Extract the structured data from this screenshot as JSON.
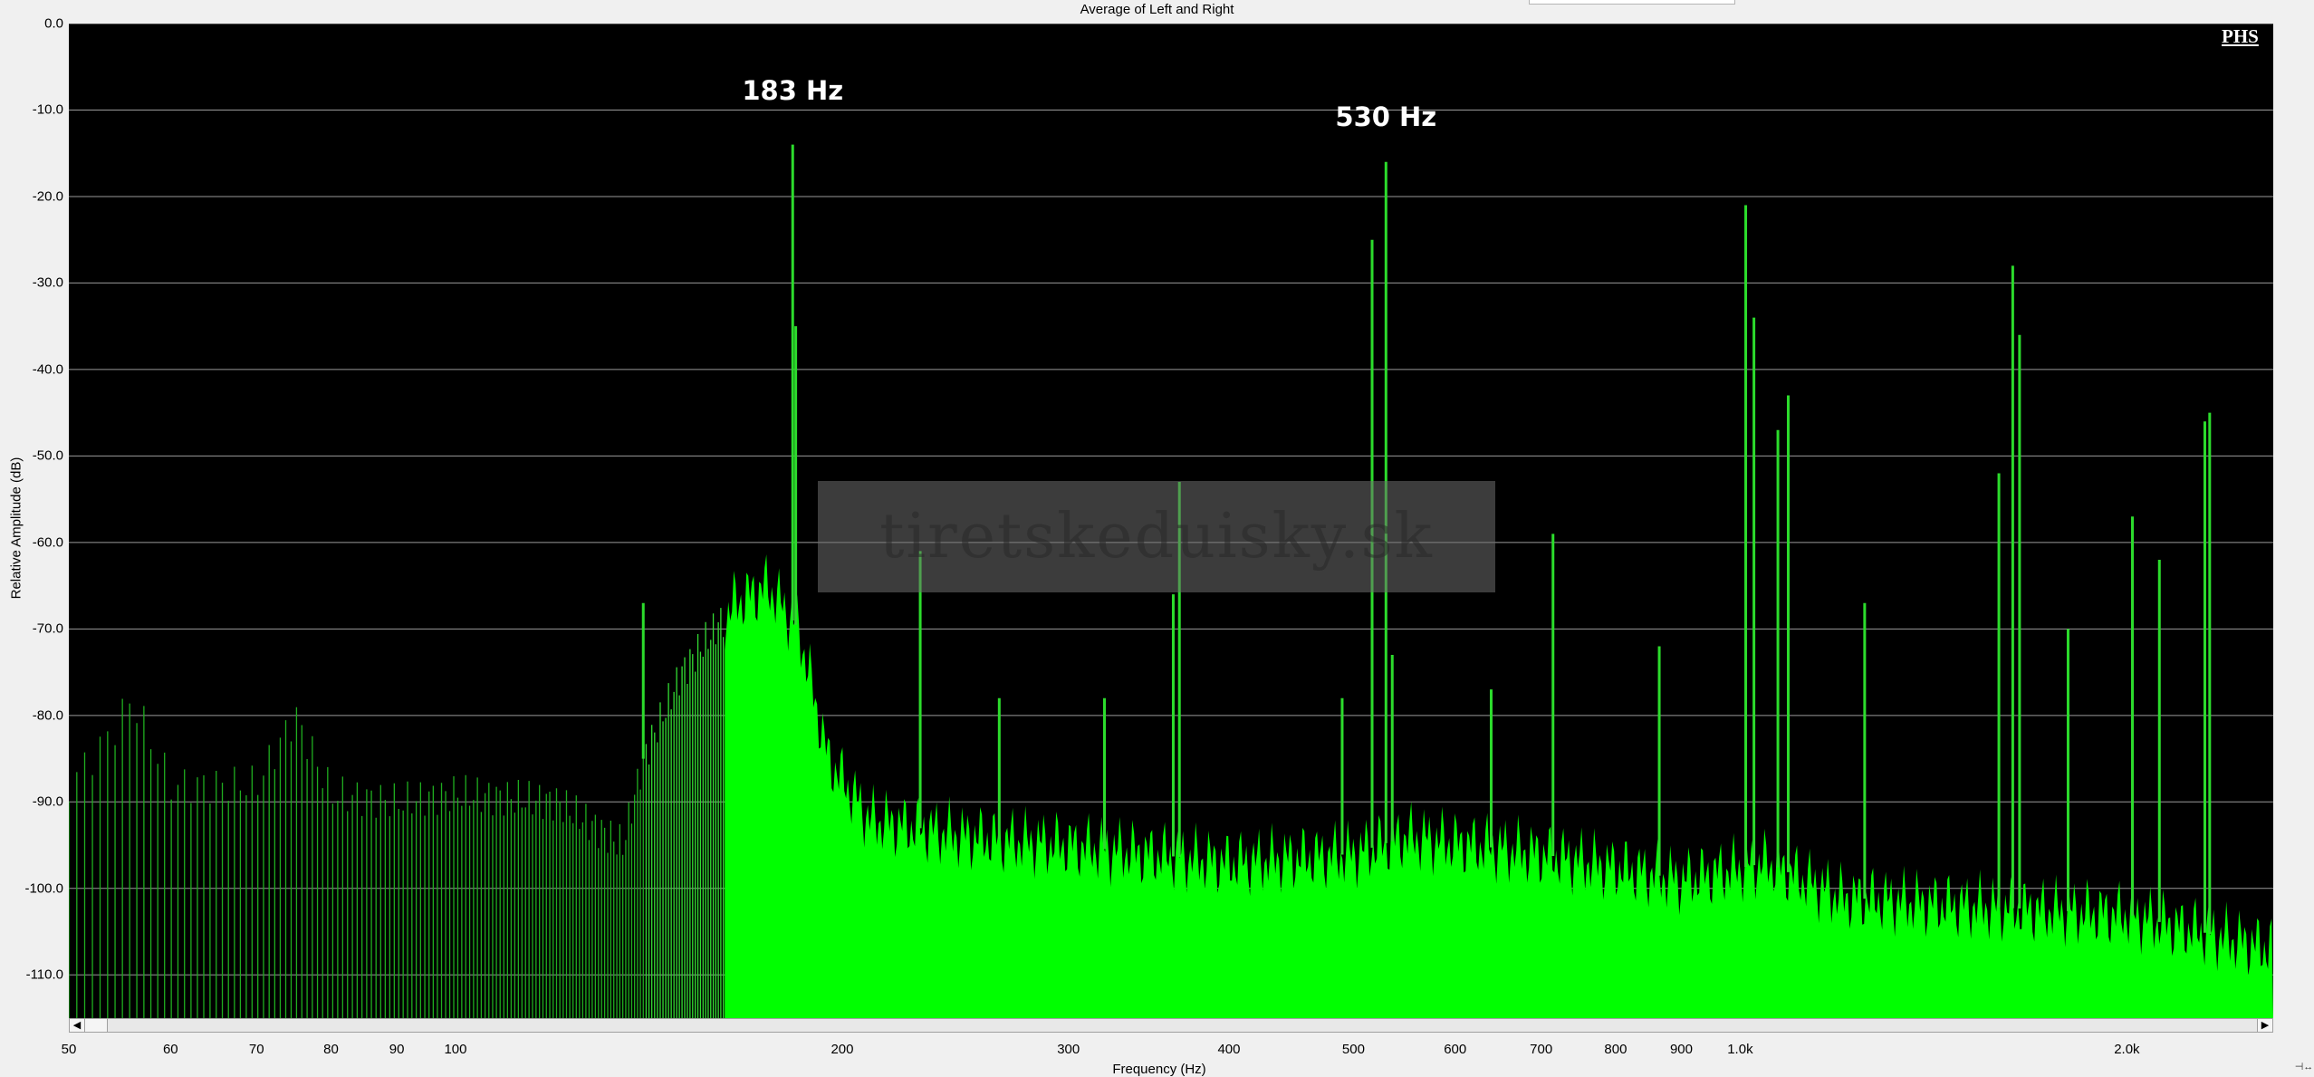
{
  "chart_data": {
    "type": "area",
    "title": "Average of Left and Right",
    "xlabel": "Frequency (Hz)",
    "ylabel": "Relative Amplitude (dB)",
    "x_scale": "log",
    "xlim": [
      50,
      2600
    ],
    "ylim": [
      -115,
      0
    ],
    "grid": true,
    "color": "#00ff00",
    "background": "#000000",
    "y_ticks": [
      0,
      -10,
      -20,
      -30,
      -40,
      -50,
      -60,
      -70,
      -80,
      -90,
      -100,
      -110
    ],
    "y_tick_labels": [
      "0.0",
      "-10.0",
      "-20.0",
      "-30.0",
      "-40.0",
      "-50.0",
      "-60.0",
      "-70.0",
      "-80.0",
      "-90.0",
      "-100.0",
      "-110.0"
    ],
    "x_ticks": [
      50,
      60,
      70,
      80,
      90,
      100,
      200,
      300,
      400,
      500,
      600,
      700,
      800,
      900,
      1000,
      2000
    ],
    "x_tick_labels": [
      "50",
      "60",
      "70",
      "80",
      "90",
      "100",
      "200",
      "300",
      "400",
      "500",
      "600",
      "700",
      "800",
      "900",
      "1.0k",
      "2.0k"
    ],
    "noise_floor": [
      {
        "x": 50,
        "y": -88
      },
      {
        "x": 54,
        "y": -82
      },
      {
        "x": 56,
        "y": -78
      },
      {
        "x": 60,
        "y": -88
      },
      {
        "x": 70,
        "y": -88
      },
      {
        "x": 75,
        "y": -80
      },
      {
        "x": 80,
        "y": -89
      },
      {
        "x": 90,
        "y": -90
      },
      {
        "x": 100,
        "y": -89
      },
      {
        "x": 120,
        "y": -90
      },
      {
        "x": 135,
        "y": -95
      },
      {
        "x": 140,
        "y": -85
      },
      {
        "x": 150,
        "y": -75
      },
      {
        "x": 165,
        "y": -67
      },
      {
        "x": 175,
        "y": -65
      },
      {
        "x": 185,
        "y": -70
      },
      {
        "x": 195,
        "y": -85
      },
      {
        "x": 210,
        "y": -92
      },
      {
        "x": 250,
        "y": -94
      },
      {
        "x": 300,
        "y": -95
      },
      {
        "x": 400,
        "y": -97
      },
      {
        "x": 500,
        "y": -96
      },
      {
        "x": 550,
        "y": -94
      },
      {
        "x": 700,
        "y": -96
      },
      {
        "x": 900,
        "y": -99
      },
      {
        "x": 1050,
        "y": -97
      },
      {
        "x": 1200,
        "y": -101
      },
      {
        "x": 1500,
        "y": -102
      },
      {
        "x": 2000,
        "y": -103
      },
      {
        "x": 2600,
        "y": -107
      }
    ],
    "peaks": [
      {
        "x": 140,
        "y": -67
      },
      {
        "x": 183,
        "y": -14
      },
      {
        "x": 184,
        "y": -35
      },
      {
        "x": 230,
        "y": -61
      },
      {
        "x": 265,
        "y": -78
      },
      {
        "x": 320,
        "y": -78
      },
      {
        "x": 362,
        "y": -66
      },
      {
        "x": 366,
        "y": -53
      },
      {
        "x": 490,
        "y": -78
      },
      {
        "x": 517,
        "y": -25
      },
      {
        "x": 530,
        "y": -16
      },
      {
        "x": 536,
        "y": -73
      },
      {
        "x": 640,
        "y": -77
      },
      {
        "x": 715,
        "y": -59
      },
      {
        "x": 865,
        "y": -72
      },
      {
        "x": 1010,
        "y": -21
      },
      {
        "x": 1025,
        "y": -34
      },
      {
        "x": 1070,
        "y": -47
      },
      {
        "x": 1090,
        "y": -43
      },
      {
        "x": 1250,
        "y": -67
      },
      {
        "x": 1590,
        "y": -52
      },
      {
        "x": 1630,
        "y": -28
      },
      {
        "x": 1650,
        "y": -36
      },
      {
        "x": 1800,
        "y": -70
      },
      {
        "x": 2020,
        "y": -57
      },
      {
        "x": 2120,
        "y": -62
      },
      {
        "x": 2300,
        "y": -46
      },
      {
        "x": 2320,
        "y": -45
      }
    ],
    "annotations": [
      {
        "text": "183 Hz",
        "x": 183,
        "y": -10
      },
      {
        "text": "530 Hz",
        "x": 530,
        "y": -13
      }
    ],
    "badge": "PHS"
  },
  "watermark": "tiretskeduisky.sk"
}
